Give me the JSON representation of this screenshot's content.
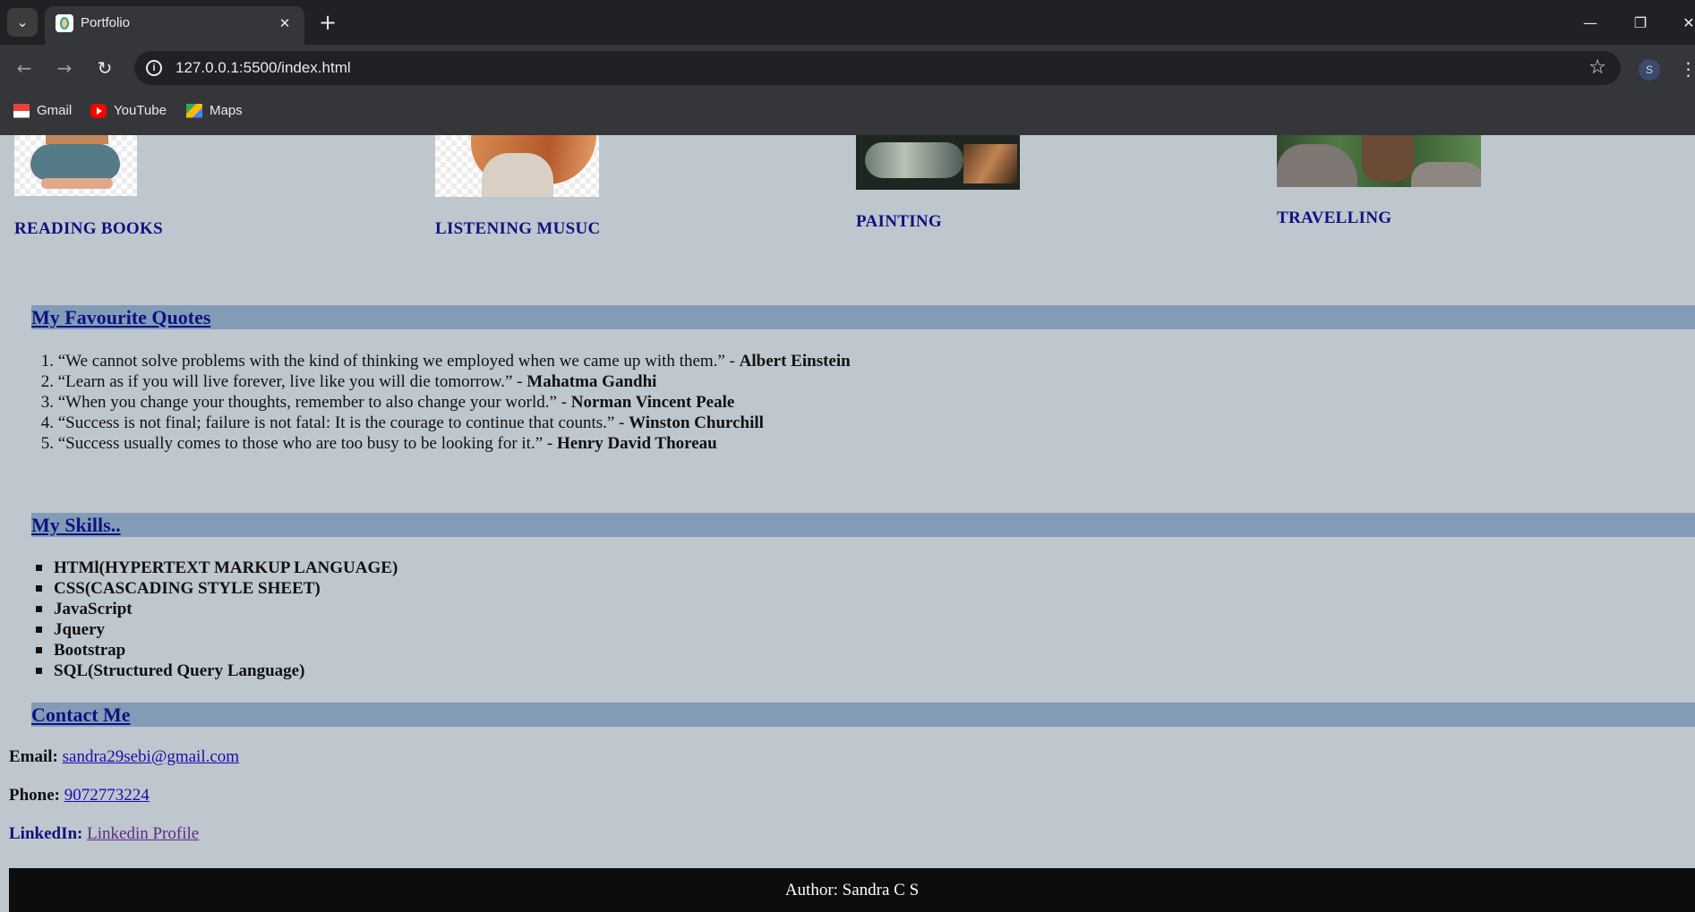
{
  "browser": {
    "tab_title": "Portfolio",
    "url": "127.0.0.1:5500/index.html",
    "profile_initial": "S",
    "bookmarks": [
      {
        "label": "Gmail",
        "icon": "gmail-icon"
      },
      {
        "label": "YouTube",
        "icon": "youtube-icon"
      },
      {
        "label": "Maps",
        "icon": "maps-icon"
      }
    ]
  },
  "hobbies": [
    {
      "label": "READING BOOKS",
      "image": "reading-books-image"
    },
    {
      "label": "LISTENING MUSUC",
      "image": "listening-music-image"
    },
    {
      "label": "PAINTING",
      "image": "painting-image"
    },
    {
      "label": "TRAVELLING",
      "image": "travelling-image"
    }
  ],
  "quotes_section": {
    "title": "My Favourite Quotes",
    "items": [
      {
        "number": "1.",
        "text": "“We cannot solve problems with the kind of thinking we employed when we came up with them.” - ",
        "author": "Albert Einstein"
      },
      {
        "number": "2.",
        "text": "“Learn as if you will live forever, live like you will die tomorrow.” - ",
        "author": "Mahatma Gandhi"
      },
      {
        "number": "3.",
        "text": "“When you change your thoughts, remember to also change your world.” - ",
        "author": "Norman Vincent Peale"
      },
      {
        "number": "4.",
        "text": "“Success is not final; failure is not fatal: It is the courage to continue that counts.” - ",
        "author": "Winston Churchill"
      },
      {
        "number": "5.",
        "text": "“Success usually comes to those who are too busy to be looking for it.” - ",
        "author": "Henry David Thoreau"
      }
    ]
  },
  "skills_section": {
    "title": "My Skills..",
    "items": [
      "HTMl(HYPERTEXT MARKUP LANGUAGE)",
      "CSS(CASCADING STYLE SHEET)",
      "JavaScript",
      "Jquery",
      "Bootstrap",
      "SQL(Structured Query Language)"
    ]
  },
  "contact_section": {
    "title": "Contact Me",
    "email_label": "Email:",
    "email_value": "sandra29sebi@gmail.com",
    "phone_label": "Phone:",
    "phone_value": "9072773224",
    "linkedin_label": "LinkedIn:",
    "linkedin_value": "Linkedin Profile"
  },
  "footer": {
    "text": "Author: Sandra C S"
  },
  "colors": {
    "page_background": "#bec6ce",
    "section_bar": "#829cb8",
    "heading": "#0e1280",
    "link": "#1a0dab",
    "footer_background": "#0b0d0f"
  }
}
